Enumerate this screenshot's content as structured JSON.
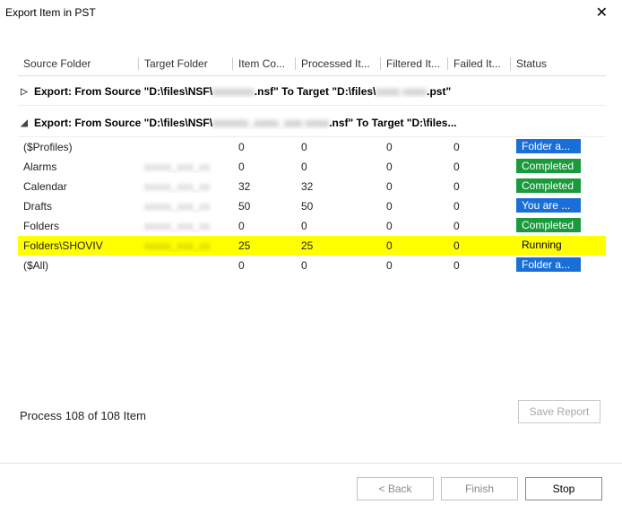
{
  "window": {
    "title": "Export Item in PST",
    "close_glyph": "✕"
  },
  "columns": {
    "source": "Source Folder",
    "target": "Target Folder",
    "item_count": "Item Co...",
    "processed": "Processed It...",
    "filtered": "Filtered It...",
    "failed": "Failed It...",
    "status": "Status"
  },
  "groups": [
    {
      "expanded": false,
      "prefix": "Export: From Source \"D:\\files\\NSF\\",
      "obscured1": "xxxxxxx",
      "mid": ".nsf\" To Target \"D:\\files\\",
      "obscured2": "xxxx xxxx",
      "suffix": ".pst\""
    },
    {
      "expanded": true,
      "prefix": "Export: From Source \"D:\\files\\NSF\\",
      "obscured1": "xxxxxx_xxxx_xxx  xxxx",
      "mid": ".nsf\" To Target \"D:\\files...",
      "obscured2": "",
      "suffix": ""
    }
  ],
  "rows": [
    {
      "source": "($Profiles)",
      "target_obscured": "",
      "ic": "0",
      "pi": "0",
      "fi": "0",
      "fa": "0",
      "status_text": "Folder a...",
      "status_kind": "blue",
      "highlight": false
    },
    {
      "source": "Alarms",
      "target_obscured": "xxxxx_xxx_xx",
      "ic": "0",
      "pi": "0",
      "fi": "0",
      "fa": "0",
      "status_text": "Completed",
      "status_kind": "green",
      "highlight": false
    },
    {
      "source": "Calendar",
      "target_obscured": "xxxxx_xxx_xx",
      "ic": "32",
      "pi": "32",
      "fi": "0",
      "fa": "0",
      "status_text": "Completed",
      "status_kind": "green",
      "highlight": false
    },
    {
      "source": "Drafts",
      "target_obscured": "xxxxx_xxx_xx",
      "ic": "50",
      "pi": "50",
      "fi": "0",
      "fa": "0",
      "status_text": "You are ...",
      "status_kind": "blue",
      "highlight": false
    },
    {
      "source": "Folders",
      "target_obscured": "xxxxx_xxx_xx",
      "ic": "0",
      "pi": "0",
      "fi": "0",
      "fa": "0",
      "status_text": "Completed",
      "status_kind": "green",
      "highlight": false
    },
    {
      "source": "Folders\\SHOVIV",
      "target_obscured": "xxxxx_xxx_xx",
      "ic": "25",
      "pi": "25",
      "fi": "0",
      "fa": "0",
      "status_text": "Running",
      "status_kind": "plain",
      "highlight": true
    },
    {
      "source": "($All)",
      "target_obscured": "",
      "ic": "0",
      "pi": "0",
      "fi": "0",
      "fa": "0",
      "status_text": "Folder a...",
      "status_kind": "blue",
      "highlight": false
    }
  ],
  "process_line": "Process 108 of 108 Item",
  "buttons": {
    "save_report": "Save Report",
    "back": "< Back",
    "finish": "Finish",
    "stop": "Stop"
  }
}
